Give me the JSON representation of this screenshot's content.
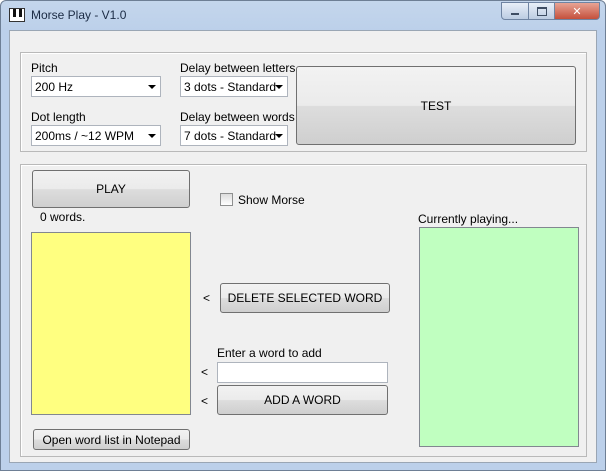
{
  "window": {
    "title": "Morse Play - V1.0"
  },
  "settings": {
    "pitch_label": "Pitch",
    "pitch_value": "200 Hz",
    "dot_length_label": "Dot length",
    "dot_length_value": "200ms / ~12 WPM",
    "delay_letters_label": "Delay between letters",
    "delay_letters_value": "3 dots - Standard",
    "delay_words_label": "Delay between words",
    "delay_words_value": "7 dots - Standard",
    "test_label": "TEST"
  },
  "main": {
    "play_label": "PLAY",
    "word_count": "0 words.",
    "show_morse_label": "Show Morse",
    "show_morse_checked": false,
    "delete_arrow": "<",
    "delete_label": "DELETE SELECTED WORD",
    "enter_word_label": "Enter a word to add",
    "enter_word_arrow": "<",
    "add_arrow": "<",
    "add_label": "ADD A WORD",
    "open_notepad_label": "Open word list in Notepad",
    "currently_playing_label": "Currently playing...",
    "word_input_value": ""
  },
  "colors": {
    "word_list_bg": "#ffff80",
    "playing_bg": "#c0ffc0"
  }
}
